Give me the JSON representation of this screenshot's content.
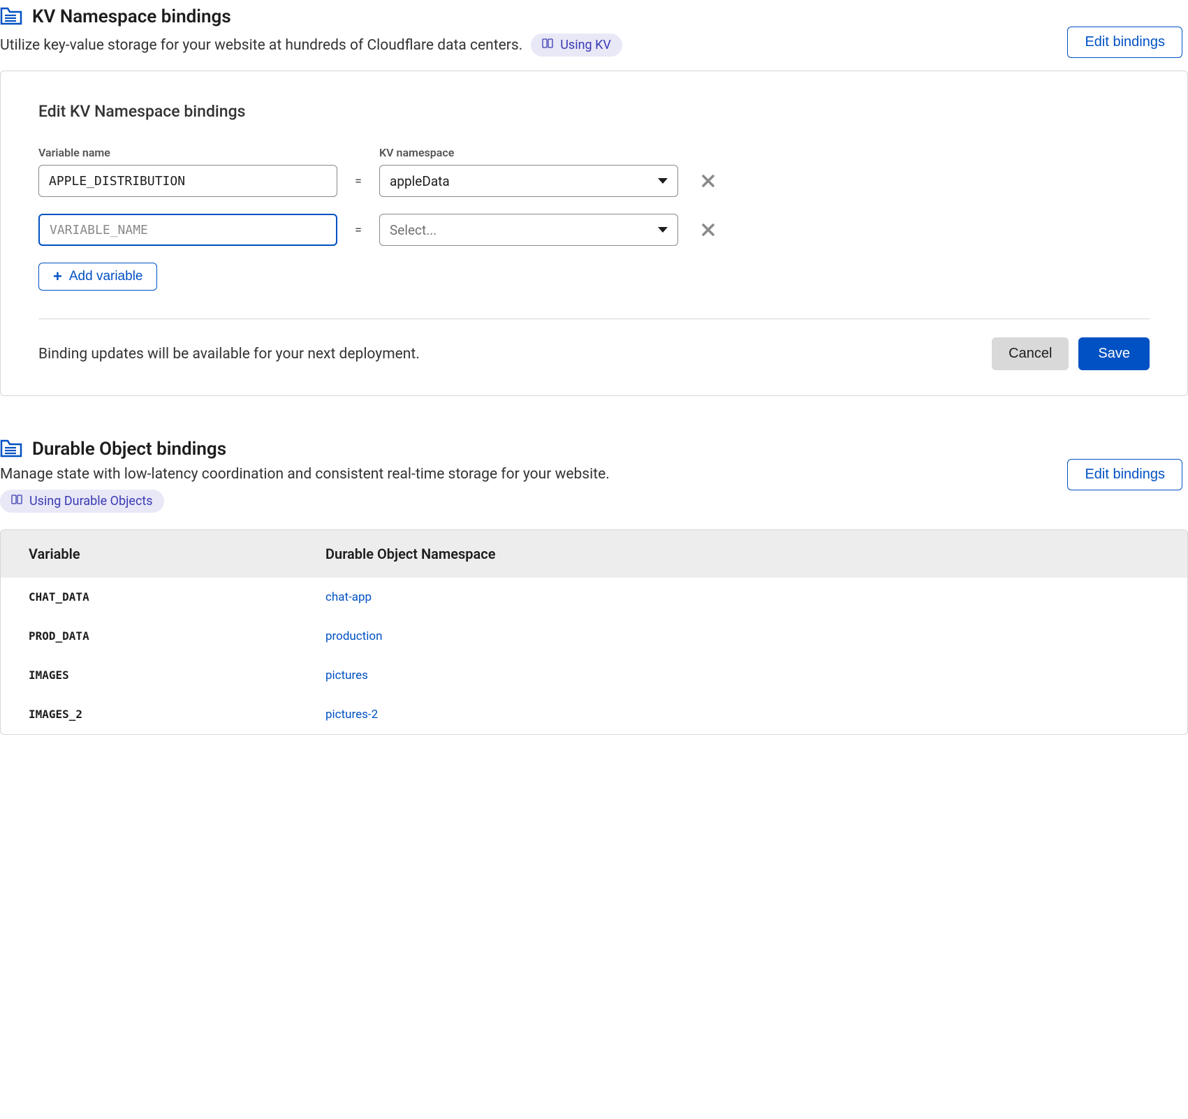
{
  "kv": {
    "title": "KV Namespace bindings",
    "desc": "Utilize key-value storage for your website at hundreds of Cloudflare data centers.",
    "doc_link": "Using KV",
    "edit_button": "Edit bindings",
    "panel": {
      "title": "Edit KV Namespace bindings",
      "col_variable": "Variable name",
      "col_namespace": "KV namespace",
      "rows": [
        {
          "variable": "APPLE_DISTRIBUTION",
          "namespace": "appleData",
          "placeholder_var": "VARIABLE_NAME",
          "placeholder_ns": "Select..."
        },
        {
          "variable": "",
          "namespace": "",
          "placeholder_var": "VARIABLE_NAME",
          "placeholder_ns": "Select..."
        }
      ],
      "add_variable": "Add variable",
      "footer_note": "Binding updates will be available for your next deployment.",
      "cancel": "Cancel",
      "save": "Save"
    }
  },
  "do": {
    "title": "Durable Object bindings",
    "desc": "Manage state with low-latency coordination and consistent real-time storage for your website.",
    "doc_link": "Using Durable Objects",
    "edit_button": "Edit bindings",
    "table": {
      "col_variable": "Variable",
      "col_namespace": "Durable Object Namespace",
      "rows": [
        {
          "variable": "CHAT_DATA",
          "namespace": "chat-app"
        },
        {
          "variable": "PROD_DATA",
          "namespace": "production"
        },
        {
          "variable": "IMAGES",
          "namespace": "pictures"
        },
        {
          "variable": "IMAGES_2",
          "namespace": "pictures-2"
        }
      ]
    }
  }
}
